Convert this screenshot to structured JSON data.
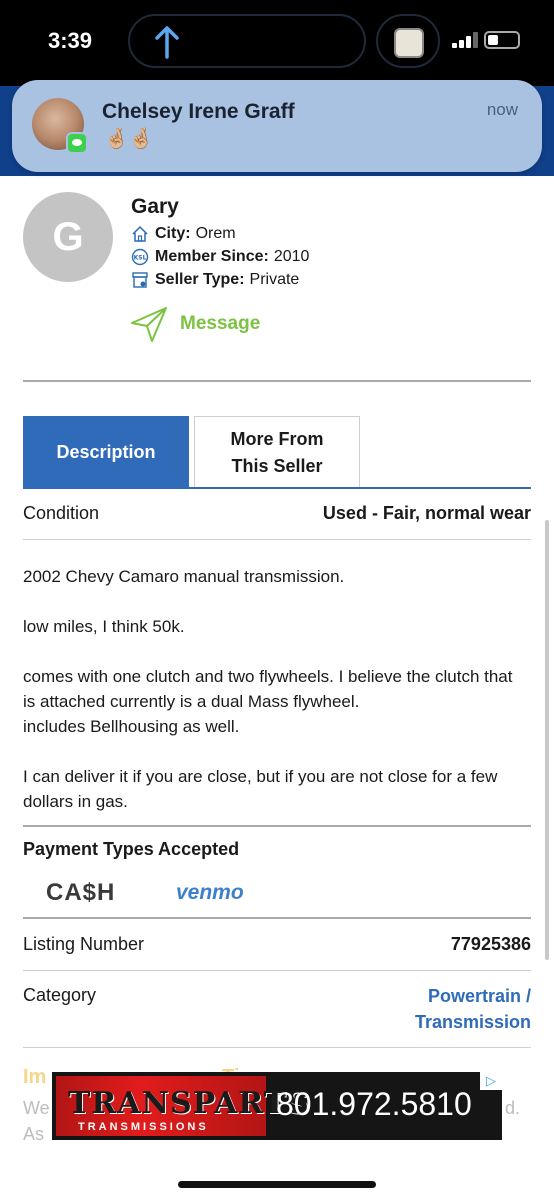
{
  "status_bar": {
    "time": "3:39"
  },
  "notification": {
    "sender": "Chelsey Irene Graff",
    "message": "🤞🏼🤞🏼",
    "time": "now"
  },
  "seller": {
    "avatar_letter": "G",
    "name": "Gary",
    "city_label": "City:",
    "city_value": "Orem",
    "member_label": "Member Since:",
    "member_value": "2010",
    "type_label": "Seller Type:",
    "type_value": "Private",
    "message_label": "Message"
  },
  "tabs": [
    {
      "label": "Description",
      "active": true
    },
    {
      "label_line1": "More From",
      "label_line2": "This Seller",
      "active": false
    }
  ],
  "condition": {
    "label": "Condition",
    "value": "Used - Fair, normal wear"
  },
  "description": {
    "p1": "2002 Chevy Camaro manual transmission.",
    "p2": "low miles, I think 50k.",
    "p3": "comes with one clutch and two flywheels. I believe the clutch that is attached currently is a dual Mass flywheel.",
    "p4": "includes Bellhousing as well.",
    "p5": "I can deliver it if you are close, but if you are not close for a few dollars in gas."
  },
  "payment": {
    "title": "Payment Types Accepted",
    "methods": [
      "CA$H",
      "venmo"
    ]
  },
  "listing_number": {
    "label": "Listing Number",
    "value": "77925386"
  },
  "category": {
    "label": "Category",
    "value_line1": "Powertrain /",
    "value_line2": "Transmission"
  },
  "faded_section": {
    "title_fragment": "Im",
    "title_fragment2": "Tip",
    "line1_start": "We",
    "line1_end": "d.",
    "line2_start": "As"
  },
  "ad": {
    "brand": "TRANSPARTS",
    "subtitle": "TRANSMISSIONS",
    "phone": "801.972.5810"
  },
  "colors": {
    "accent_blue": "#2f6bb8",
    "message_green": "#7cc243",
    "notification_bg": "#a9c2e2",
    "ad_red": "#e21c1c"
  }
}
